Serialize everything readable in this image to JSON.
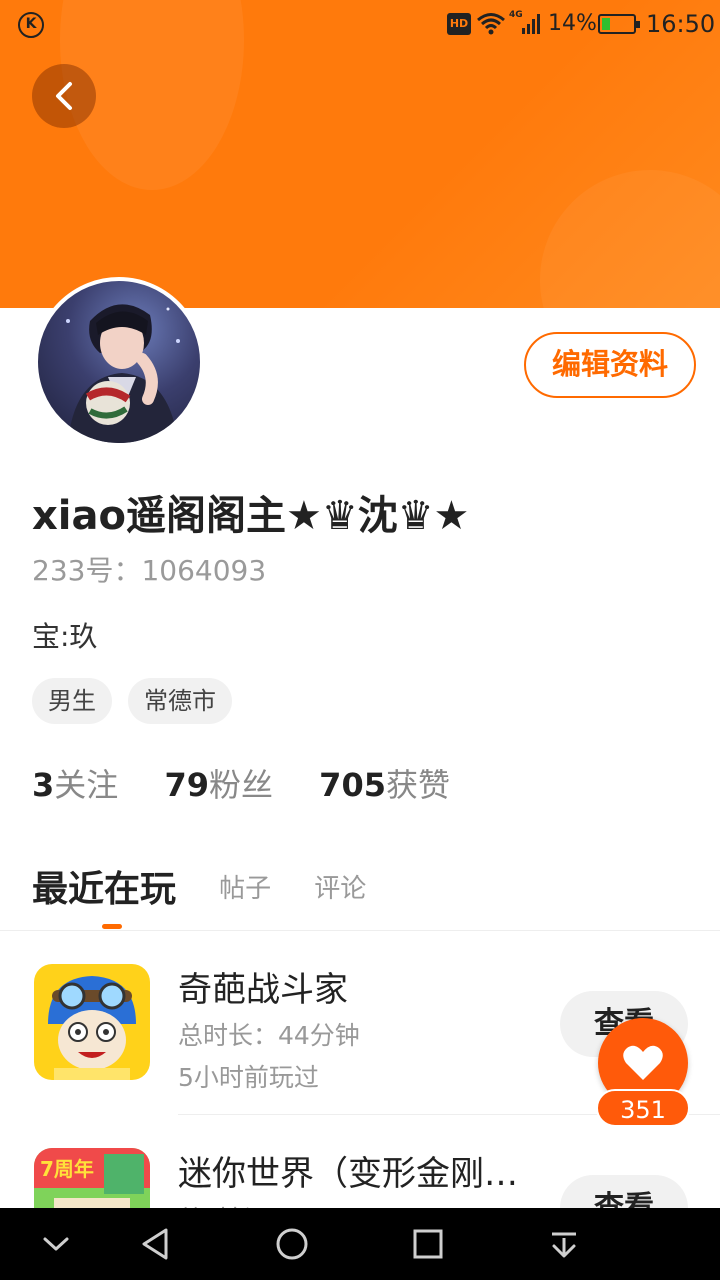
{
  "status_bar": {
    "network_badge": "HD",
    "network_type": "4G",
    "battery_percent": "14%",
    "battery_level": 0.14,
    "time": "16:50",
    "app_icon": "k-circle-icon"
  },
  "profile": {
    "edit_label": "编辑资料",
    "username": "xiao遥阁阁主★♛沈♛★",
    "uid": "233号：1064093",
    "bio": "宝:玖",
    "tags": [
      "男生",
      "常德市"
    ],
    "stats": [
      {
        "num": "3",
        "label": "关注"
      },
      {
        "num": "79",
        "label": "粉丝"
      },
      {
        "num": "705",
        "label": "获赞"
      }
    ]
  },
  "tabs": {
    "active": "最近在玩",
    "items": [
      "帖子",
      "评论"
    ]
  },
  "games": [
    {
      "title": "奇葩战斗家",
      "duration": "总时长：44分钟",
      "last_played": "5小时前玩过",
      "button": "查看"
    },
    {
      "title": "迷你世界（变形金刚…",
      "duration": "总时长：…",
      "button": "查看"
    }
  ],
  "like": {
    "count": "351",
    "icon": "heart-icon"
  },
  "colors": {
    "accent": "#ff6a00",
    "header": "#ff7a0c"
  }
}
